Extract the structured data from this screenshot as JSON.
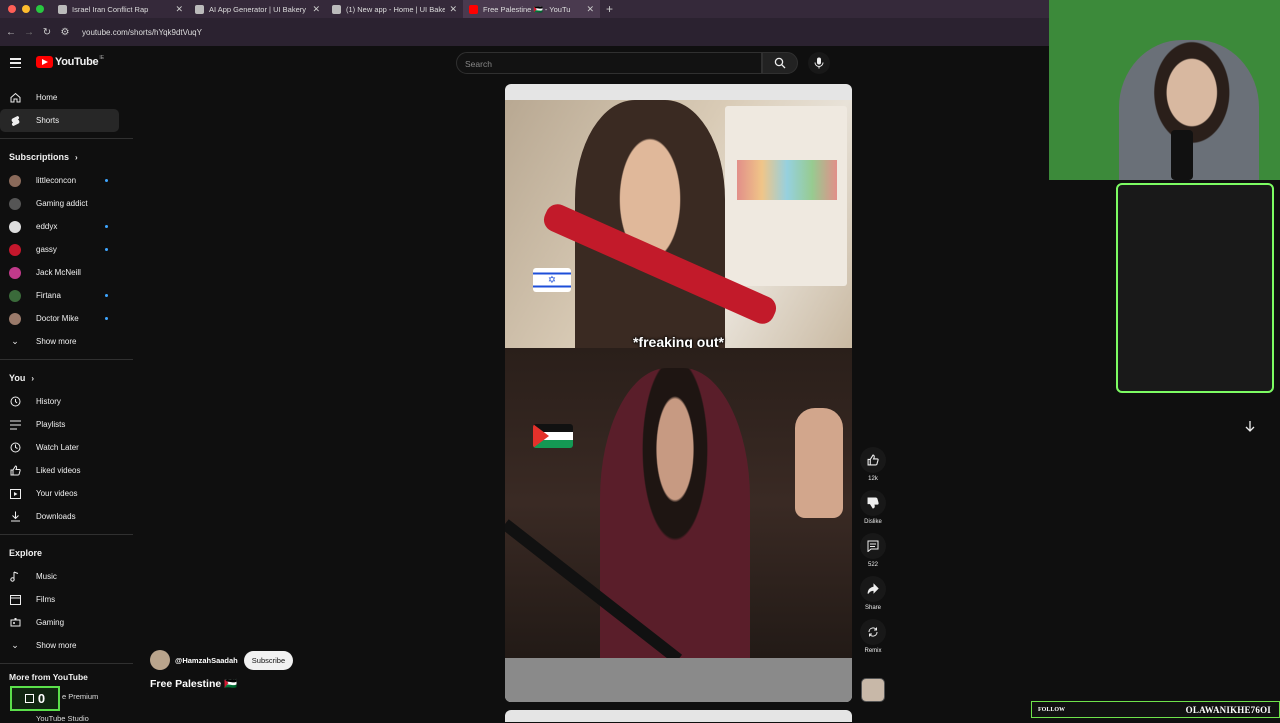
{
  "browser": {
    "tabs": [
      {
        "title": "Israel Iran Conflict Rap",
        "close": "✕"
      },
      {
        "title": "AI App Generator | UI Bakery",
        "close": "✕"
      },
      {
        "title": "(1) New app - Home | UI Bake",
        "close": "✕"
      },
      {
        "title": "Free Palestine 🇵🇸 - YouTu",
        "close": "✕"
      }
    ],
    "new_tab": "+",
    "url": "youtube.com/shorts/hYqk9dtVuqY"
  },
  "header": {
    "logo_text": "YouTube",
    "logo_country": "IE",
    "search_placeholder": "Search"
  },
  "sidebar": {
    "main": [
      {
        "label": "Home",
        "icon": "home-icon"
      },
      {
        "label": "Shorts",
        "icon": "shorts-icon"
      }
    ],
    "subscriptions_title": "Subscriptions",
    "subscriptions": [
      {
        "label": "littleconcon",
        "color": "#8a6a5a",
        "dot": true
      },
      {
        "label": "Gaming addict",
        "color": "#555",
        "dot": false
      },
      {
        "label": "eddyx",
        "color": "#ddd",
        "dot": true
      },
      {
        "label": "gassy",
        "color": "#c4172c",
        "dot": true
      },
      {
        "label": "Jack McNeill",
        "color": "#c03a8a",
        "dot": false
      },
      {
        "label": "Firtana",
        "color": "#3a6a3a",
        "dot": true
      },
      {
        "label": "Doctor Mike",
        "color": "#9a7a6a",
        "dot": true
      }
    ],
    "show_more": "Show more",
    "you_title": "You",
    "you": [
      {
        "label": "History",
        "icon": "history-icon"
      },
      {
        "label": "Playlists",
        "icon": "playlists-icon"
      },
      {
        "label": "Watch Later",
        "icon": "clock-icon"
      },
      {
        "label": "Liked videos",
        "icon": "thumbs-up-icon"
      },
      {
        "label": "Your videos",
        "icon": "video-icon"
      },
      {
        "label": "Downloads",
        "icon": "download-icon"
      }
    ],
    "explore_title": "Explore",
    "explore": [
      {
        "label": "Music",
        "icon": "music-icon"
      },
      {
        "label": "Films",
        "icon": "film-icon"
      },
      {
        "label": "Gaming",
        "icon": "gaming-icon"
      }
    ],
    "explore_show_more": "Show more",
    "more_from_title": "More from YouTube",
    "premium": "e Premium",
    "studio": "YouTube Studio"
  },
  "short": {
    "caption": "*freaking out*",
    "channel_handle": "@HamzahSaadah",
    "subscribe_label": "Subscribe",
    "title": "Free Palestine 🇵🇸",
    "actions": [
      {
        "label": "12k",
        "icon": "thumbs-up-icon"
      },
      {
        "label": "Dislike",
        "icon": "thumbs-down-icon"
      },
      {
        "label": "522",
        "icon": "comment-icon"
      },
      {
        "label": "Share",
        "icon": "share-icon"
      },
      {
        "label": "Remix",
        "icon": "remix-icon"
      }
    ]
  },
  "overlay": {
    "follow_label": "FOLLOW",
    "follow_name": "OLAWANIKHE76OI",
    "counter": "0",
    "accent": "#7dfc63"
  }
}
